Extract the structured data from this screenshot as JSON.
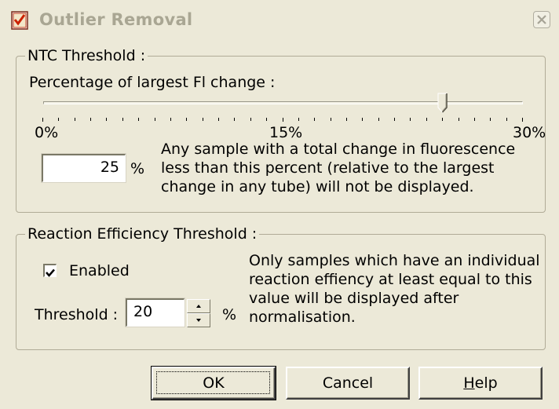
{
  "window": {
    "title": "Outlier Removal"
  },
  "ntc": {
    "group_label": "NTC Threshold :",
    "slider_caption": "Percentage of largest Fl change :",
    "slider_value_percent": 25,
    "slider_min": 0,
    "slider_max": 30,
    "tick_labels": [
      "0%",
      "15%",
      "30%"
    ],
    "value": "25",
    "unit": "%",
    "description": [
      "Any sample with a total change in fluorescence",
      "less than this percent (relative to the largest",
      "change in any tube) will not be displayed."
    ]
  },
  "ret": {
    "group_label": "Reaction Efficiency Threshold :",
    "enabled_label": "Enabled",
    "enabled": true,
    "threshold_label": "Threshold :",
    "threshold_value": "20",
    "unit": "%",
    "description": [
      "Only samples which have an individual",
      "reaction effiency at least equal to this",
      "value will be displayed after",
      "normalisation."
    ]
  },
  "buttons": {
    "ok": "OK",
    "cancel": "Cancel",
    "help": "Help"
  },
  "icons": {
    "app": "checklist-icon",
    "close": "close-icon"
  },
  "colors": {
    "dialog_bg": "#ece9d8",
    "title_text": "#a9a693",
    "icon_red": "#cc2200"
  }
}
